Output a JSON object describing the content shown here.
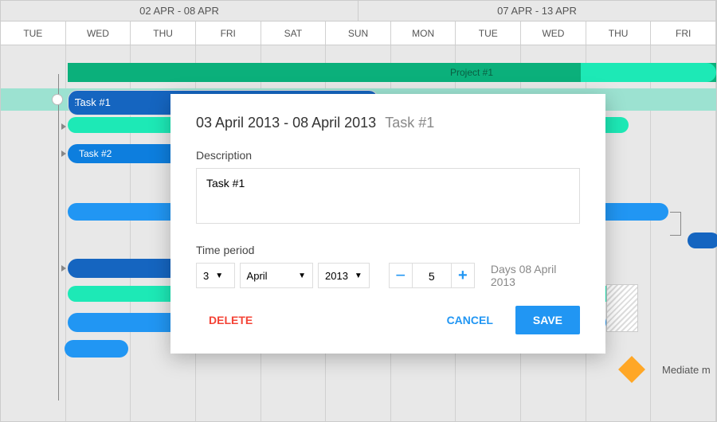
{
  "weeks": [
    "02 APR - 08 APR",
    "07 APR - 13 APR"
  ],
  "days": [
    "TUE",
    "WED",
    "THU",
    "FRI",
    "SAT",
    "SUN",
    "MON",
    "TUE",
    "WED",
    "THU",
    "FRI"
  ],
  "project_label": "Project #1",
  "task1_label": "Task #1",
  "task2_label": "Task #2",
  "milestone_label": "Mediate m",
  "dialog": {
    "title_range": "03 April 2013 - 08 April 2013",
    "title_task": "Task #1",
    "desc_label": "Description",
    "desc_value": "Task #1",
    "period_label": "Time period",
    "day": "3",
    "month": "April",
    "year": "2013",
    "step_value": "5",
    "days_text": "Days 08 April 2013",
    "delete": "DELETE",
    "cancel": "CANCEL",
    "save": "SAVE"
  }
}
